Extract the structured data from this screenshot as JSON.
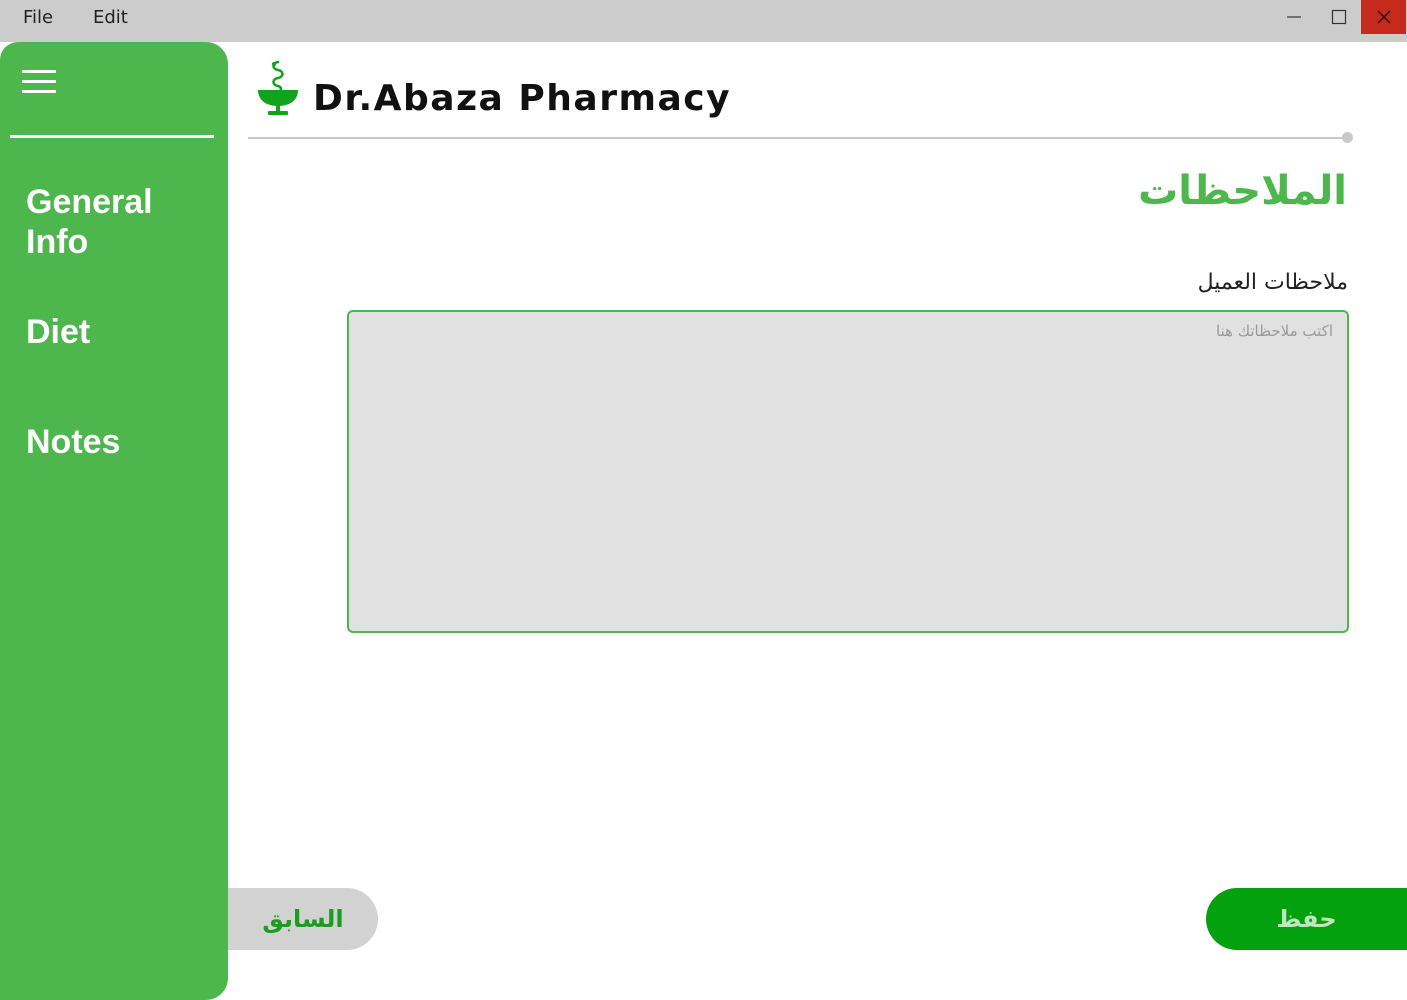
{
  "menubar": {
    "items": [
      "File",
      "Edit"
    ]
  },
  "window_controls": {
    "minimize_icon": "minimize-icon",
    "maximize_icon": "maximize-icon",
    "close_icon": "close-icon"
  },
  "sidebar": {
    "menu_icon": "hamburger-menu-icon",
    "items": [
      {
        "label": "General\nInfo"
      },
      {
        "label": "Diet"
      },
      {
        "label": "Notes"
      }
    ]
  },
  "header": {
    "logo_icon": "pharmacy-bowl-of-hygieia-icon",
    "brand": "Dr.Abaza Pharmacy"
  },
  "main": {
    "title": "الملاحظات",
    "notes_label": "ملاحظات العميل",
    "notes_placeholder": "اكتب ملاحظاتك هنا",
    "notes_value": ""
  },
  "actions": {
    "prev_label": "السابق",
    "save_label": "حفظ"
  },
  "colors": {
    "accent": "#4db74e",
    "save": "#04a10f",
    "titlebar": "#cccccc",
    "close": "#c42b1c"
  }
}
